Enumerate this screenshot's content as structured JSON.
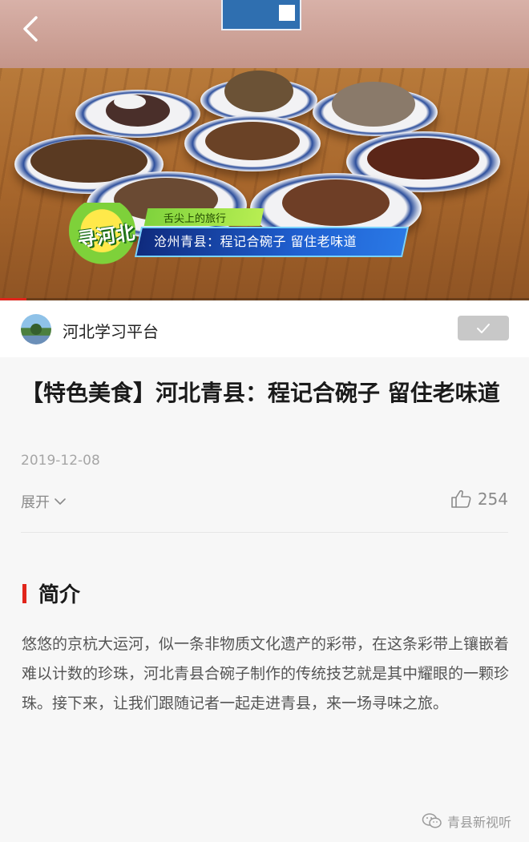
{
  "video": {
    "caption_sub": "舌尖上的旅行",
    "caption_main": "沧州青县：程记合碗子 留住老味道",
    "logo_text": "寻河北",
    "progress": 0.05
  },
  "account": {
    "name": "河北学习平台"
  },
  "article": {
    "title": "【特色美食】河北青县：程记合碗子  留住老味道",
    "date": "2019-12-08",
    "expand_label": "展开",
    "like_count": "254",
    "section_title": "简介",
    "intro": "悠悠的京杭大运河，似一条非物质文化遗产的彩带，在这条彩带上镶嵌着难以计数的珍珠，河北青县合碗子制作的传统技艺就是其中耀眼的一颗珍珠。接下来，让我们跟随记者一起走进青县，来一场寻味之旅。"
  },
  "watermark": {
    "text": "青县新视听"
  },
  "colors": {
    "accent": "#e1251b",
    "banner_blue": "#1f5fd0",
    "banner_green": "#8fdc44"
  }
}
